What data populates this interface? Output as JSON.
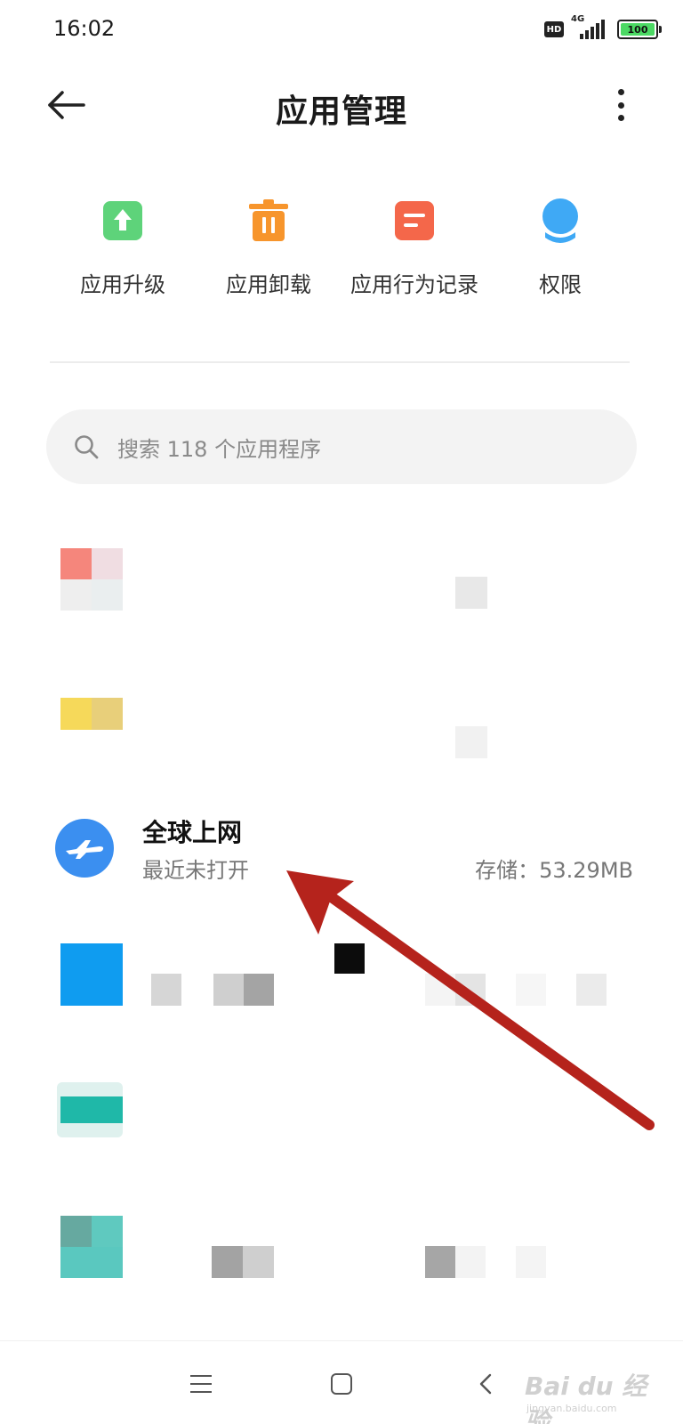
{
  "status_bar": {
    "time": "16:02",
    "hd_label": "HD",
    "network_label": "4G",
    "battery_level": "100"
  },
  "header": {
    "title": "应用管理",
    "back_icon": "arrow-left-icon",
    "more_icon": "more-vertical-icon"
  },
  "quick_actions": [
    {
      "label": "应用升级",
      "icon": "upgrade-icon",
      "color": "#5ed37a"
    },
    {
      "label": "应用卸载",
      "icon": "trash-icon",
      "color": "#f7952c"
    },
    {
      "label": "应用行为记录",
      "icon": "record-icon",
      "color": "#f4674a"
    },
    {
      "label": "权限",
      "icon": "permission-icon",
      "color": "#3fa9f5"
    }
  ],
  "search": {
    "placeholder": "搜索 118 个应用程序"
  },
  "apps": [
    {
      "name": "全球上网",
      "subtitle": "最近未打开",
      "storage": "存储：53.29MB",
      "icon": "airplane-icon",
      "icon_color": "#3b8ff0"
    }
  ],
  "nav_bar": {
    "menu_icon": "menu-icon",
    "home_icon": "home-icon",
    "back_icon": "back-chevron-icon"
  },
  "watermark": {
    "brand": "Bai du 经验",
    "url": "jingyan.baidu.com"
  },
  "colors": {
    "annotation_arrow": "#b5231c",
    "accent_blue": "#3b8ff0"
  }
}
